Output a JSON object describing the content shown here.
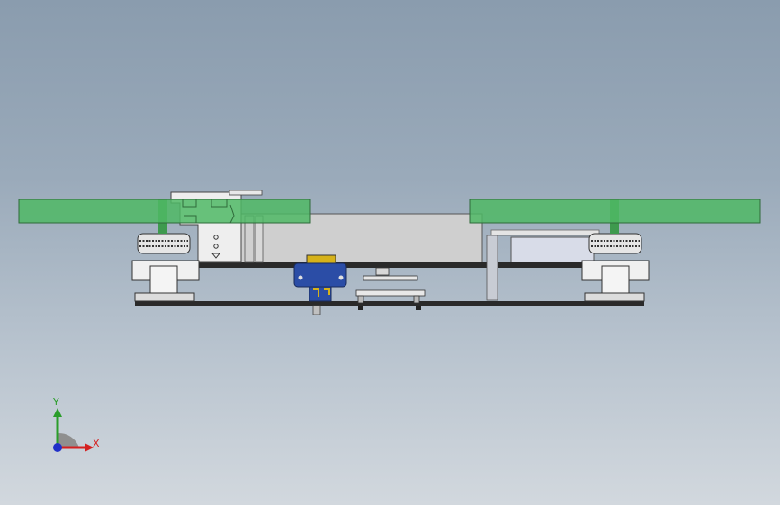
{
  "colors": {
    "propeller": "#54b86a",
    "board": "#1e1e1e",
    "servo": "#2b4da6",
    "axis_x": "#d42020",
    "axis_y": "#2a9d2a",
    "axis_z": "#2030c8"
  },
  "triad": {
    "x_label": "X",
    "y_label": "Y"
  }
}
